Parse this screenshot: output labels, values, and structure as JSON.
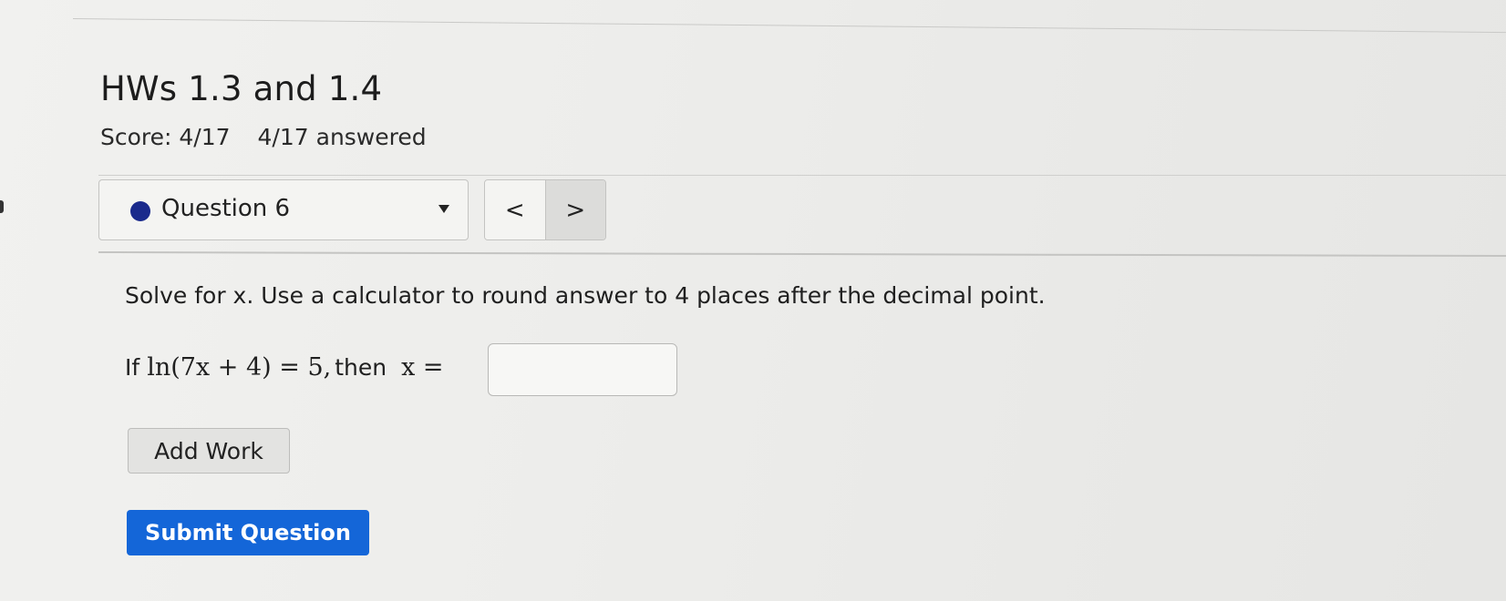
{
  "assignment": {
    "title": "HWs 1.3 and 1.4",
    "score": "Score: 4/17",
    "answered": "4/17 answered"
  },
  "navigation": {
    "question_label": "Question 6",
    "prev_label": "<",
    "next_label": ">"
  },
  "question": {
    "prompt": "Solve for x. Use a calculator to round answer to 4 places after the decimal point.",
    "if_text": "If",
    "equation": "ln(7x + 4) = 5,",
    "then_text": "then",
    "lhs_var": "x =",
    "answer_value": ""
  },
  "actions": {
    "add_work_label": "Add Work",
    "submit_label": "Submit Question"
  },
  "colors": {
    "accent_blue": "#1466d8",
    "question_dot": "#1a2a8c"
  }
}
